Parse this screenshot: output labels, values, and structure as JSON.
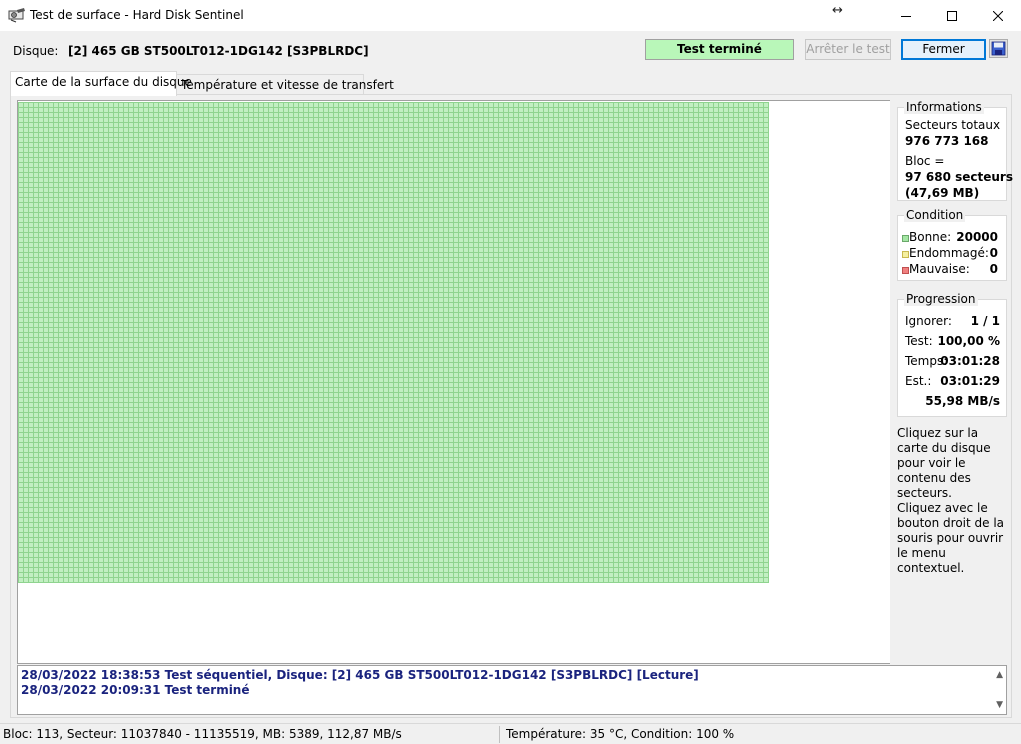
{
  "window": {
    "title": "Test de surface - Hard Disk Sentinel",
    "move_glyph": "↔",
    "controls": [
      "minimize-icon",
      "maximize-icon",
      "close-icon"
    ]
  },
  "disk": {
    "label": "Disque:",
    "name": "[2] 465 GB  ST500LT012-1DG142 [S3PBLRDC]"
  },
  "status": {
    "text": "Test terminé",
    "color": "#b9f7b9"
  },
  "buttons": {
    "stop": "Arrêter le test",
    "close": "Fermer"
  },
  "tabs": [
    {
      "label": "Carte de la surface du disque"
    },
    {
      "label": "Température et vitesse de transfert"
    }
  ],
  "info": {
    "title": "Informations",
    "total_label": "Secteurs totaux",
    "total_value": "976 773 168",
    "block_label": "Bloc =",
    "block_value": "97 680 secteurs",
    "block_size": "(47,69 MB)"
  },
  "condition": {
    "title": "Condition",
    "rows": [
      {
        "label": "Bonne:",
        "value": "20000",
        "color": "#a4e6a4"
      },
      {
        "label": "Endommagé:",
        "value": "0",
        "color": "#f5f0a0"
      },
      {
        "label": "Mauvaise:",
        "value": "0",
        "color": "#f08080"
      }
    ]
  },
  "progress": {
    "title": "Progression",
    "rows": [
      {
        "label": "Ignorer:",
        "value": "1 / 1"
      },
      {
        "label": "Test:",
        "value": "100,00 %"
      },
      {
        "label": "Temps:",
        "value": "03:01:28"
      },
      {
        "label": "Est.:",
        "value": "03:01:29"
      }
    ],
    "speed": "55,98 MB/s"
  },
  "help": {
    "click_text": "Cliquez sur la carte du disque pour voir le contenu des secteurs.",
    "right_click_text": "Cliquez avec le bouton droit de la souris pour ouvrir le menu contextuel."
  },
  "log": [
    "28/03/2022  18:38:53   Test séquentiel, Disque: [2] 465 GB  ST500LT012-1DG142 [S3PBLRDC] [Lecture]",
    "28/03/2022  20:09:31   Test terminé"
  ],
  "statusbar": {
    "left": "Bloc: 113, Secteur: 11037840 - 11135519, MB: 5389, 112,87 MB/s",
    "right": "Température: 35  °C,  Condition: 100 %"
  },
  "grid": {
    "color": "#c2efc2",
    "line_color": "#8fd48f"
  }
}
